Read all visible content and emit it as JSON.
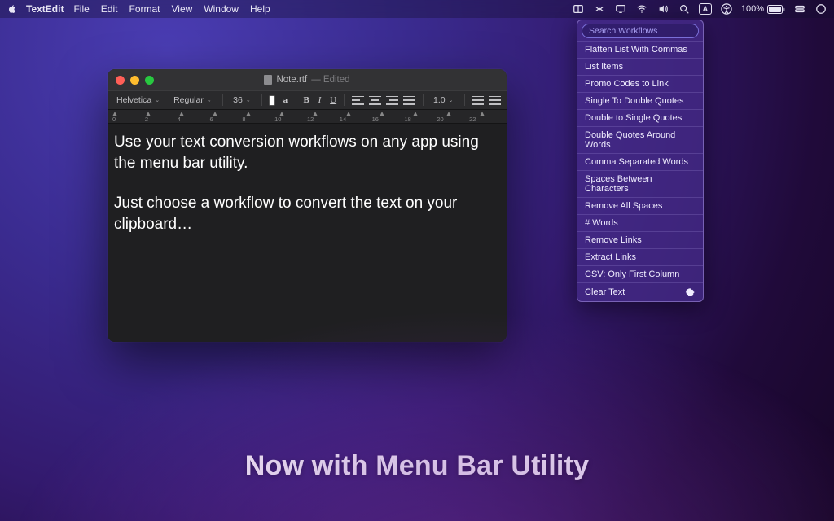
{
  "menubar": {
    "app_name": "TextEdit",
    "items": [
      "File",
      "Edit",
      "Format",
      "View",
      "Window",
      "Help"
    ],
    "status_letter": "A",
    "battery_text": "100%"
  },
  "workflows": {
    "search_placeholder": "Search Workflows",
    "items": [
      "Flatten List With Commas",
      "List Items",
      "Promo Codes to Link",
      "Single To Double Quotes",
      "Double to Single Quotes",
      "Double Quotes Around Words",
      "Comma Separated Words",
      "Spaces Between Characters",
      "Remove All Spaces",
      "# Words",
      "Remove Links",
      "Extract Links",
      "CSV: Only First Column",
      "Clear Text"
    ]
  },
  "window": {
    "doc_title": "Note.rtf",
    "edited_suffix": " — Edited",
    "toolbar": {
      "font_family": "Helvetica",
      "font_style": "Regular",
      "font_size": "36",
      "line_spacing": "1.0"
    },
    "ruler_marks": [
      "0",
      "2",
      "4",
      "6",
      "8",
      "10",
      "12",
      "14",
      "16",
      "18",
      "20",
      "22"
    ],
    "body_p1": "Use your text conversion workflows on any app using the menu bar utility.",
    "body_p2": "Just choose a workflow to convert the text on your clipboard…"
  },
  "hero": "Now with Menu Bar Utility"
}
